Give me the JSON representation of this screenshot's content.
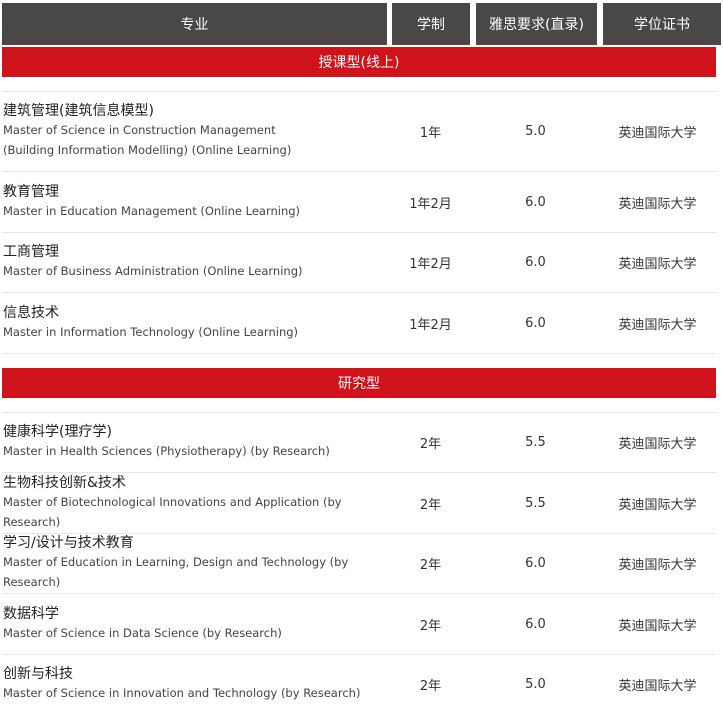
{
  "header": {
    "major": "专业",
    "duration": "学制",
    "ielts": "雅思要求(直录)",
    "certificate": "学位证书"
  },
  "sections": [
    {
      "title": "授课型(线上)",
      "rows": [
        {
          "zh": "建筑管理(建筑信息模型)",
          "en1": "Master of Science in Construction Management",
          "en2": "(Building Information Modelling) (Online Learning)",
          "duration": "1年",
          "ielts": "5.0",
          "certificate": "英迪国际大学"
        },
        {
          "zh": "教育管理",
          "en1": "Master in Education Management (Online Learning)",
          "duration": "1年2月",
          "ielts": "6.0",
          "certificate": "英迪国际大学"
        },
        {
          "zh": "工商管理",
          "en1": "Master of Business Administration (Online Learning)",
          "duration": "1年2月",
          "ielts": "6.0",
          "certificate": "英迪国际大学"
        },
        {
          "zh": "信息技术",
          "en1": "Master in Information Technology (Online Learning)",
          "duration": "1年2月",
          "ielts": "6.0",
          "certificate": "英迪国际大学"
        }
      ]
    },
    {
      "title": "研究型",
      "rows": [
        {
          "zh": "健康科学(理疗学)",
          "en1": "Master in Health Sciences (Physiotherapy) (by Research)",
          "duration": "2年",
          "ielts": "5.5",
          "certificate": "英迪国际大学"
        },
        {
          "zh": "生物科技创新&技术",
          "en1": "Master of Biotechnological Innovations and Application (by Research)",
          "duration": "2年",
          "ielts": "5.5",
          "certificate": "英迪国际大学"
        },
        {
          "zh": "学习/设计与技术教育",
          "en1": "Master of Education in Learning, Design and Technology (by Research)",
          "duration": "2年",
          "ielts": "6.0",
          "certificate": "英迪国际大学"
        },
        {
          "zh": "数据科学",
          "en1": "Master of Science in Data Science (by Research)",
          "duration": "2年",
          "ielts": "6.0",
          "certificate": "英迪国际大学"
        },
        {
          "zh": "创新与科技",
          "en1": "Master of Science in Innovation and Technology (by Research)",
          "duration": "2年",
          "ielts": "5.0",
          "certificate": "英迪国际大学"
        }
      ]
    }
  ],
  "colors": {
    "header_bg": "#4a4747",
    "section_bg": "#d0121b",
    "divider": "#e6e6e6"
  }
}
